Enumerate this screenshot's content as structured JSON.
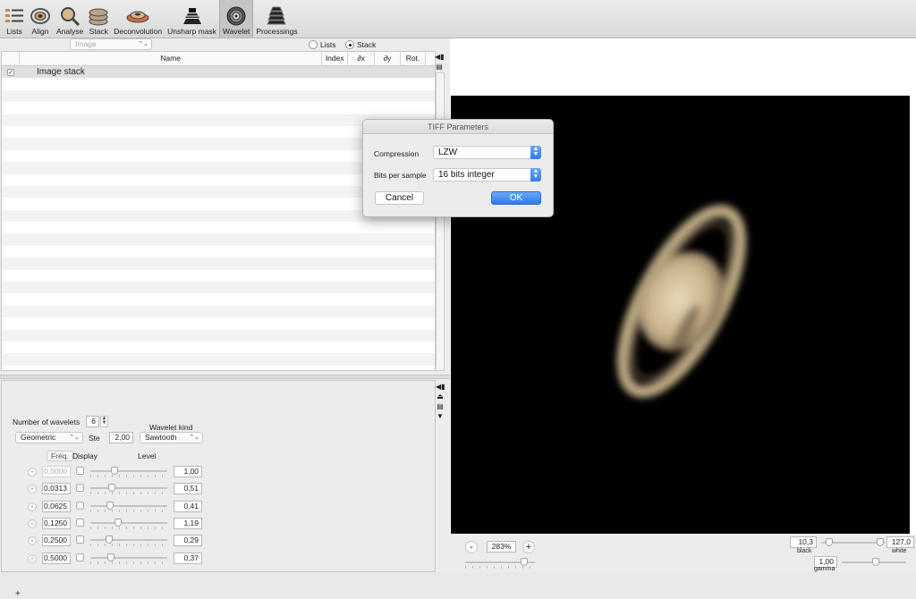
{
  "toolbar": {
    "items": [
      {
        "label": "Lists",
        "icon": "lists-icon"
      },
      {
        "label": "Align",
        "icon": "align-icon"
      },
      {
        "label": "Analyse",
        "icon": "analyse-icon"
      },
      {
        "label": "Stack",
        "icon": "stack-icon"
      },
      {
        "label": "Deconvolution",
        "icon": "deconvolution-icon"
      },
      {
        "label": "Unsharp mask",
        "icon": "unsharp-mask-icon"
      },
      {
        "label": "Wavelet",
        "icon": "wavelet-icon",
        "active": true
      },
      {
        "label": "Processings",
        "icon": "processings-icon"
      }
    ]
  },
  "list_panel": {
    "image_select": "Image",
    "radio_lists": "Lists",
    "radio_stack": "Stack",
    "selected_radio": "Stack",
    "columns": [
      "Name",
      "Index",
      "∂x",
      "∂y",
      "Rot."
    ],
    "rows": [
      {
        "checked": "✓",
        "name": "Image stack"
      }
    ]
  },
  "wavelet_panel": {
    "num_wavelets_label": "Number of wavelets",
    "num_wavelets": "6",
    "scale_select": "Geometric",
    "step_label": "Ste",
    "step_value": "2,00",
    "kind_label": "Wavelet kind",
    "kind_value": "Sawtooth",
    "freq_header": "Fréq.",
    "display_header": "Display",
    "level_header": "Level",
    "plus_label": "+",
    "rows": [
      {
        "freq": "0,0000",
        "level": "1,00",
        "slider": 0.3,
        "dim": true
      },
      {
        "freq": "0,0313",
        "level": "0,51",
        "slider": 0.25
      },
      {
        "freq": "0,0625",
        "level": "0,41",
        "slider": 0.23
      },
      {
        "freq": "0,1250",
        "level": "1,19",
        "slider": 0.35
      },
      {
        "freq": "0,2500",
        "level": "0,29",
        "slider": 0.22
      },
      {
        "freq": "0,5000",
        "level": "0,37",
        "slider": 0.24
      }
    ]
  },
  "viewer": {
    "zoom_minus": "-",
    "zoom_plus": "+",
    "zoom": "283%",
    "black_value": "10,3",
    "black_label": "black",
    "white_value": "127,0",
    "white_label": "white",
    "gamma_value": "1,00",
    "gamma_label": "gamma"
  },
  "dialog": {
    "title": "TIFF Parameters",
    "compression_label": "Compression",
    "compression_value": "LZW",
    "bits_label": "Bits per sample",
    "bits_value": "16 bits integer",
    "cancel_label": "Cancel",
    "ok_label": "OK"
  },
  "colors": {
    "accent": "#2f7bf1",
    "background": "#ececec",
    "image_background": "#000000"
  }
}
